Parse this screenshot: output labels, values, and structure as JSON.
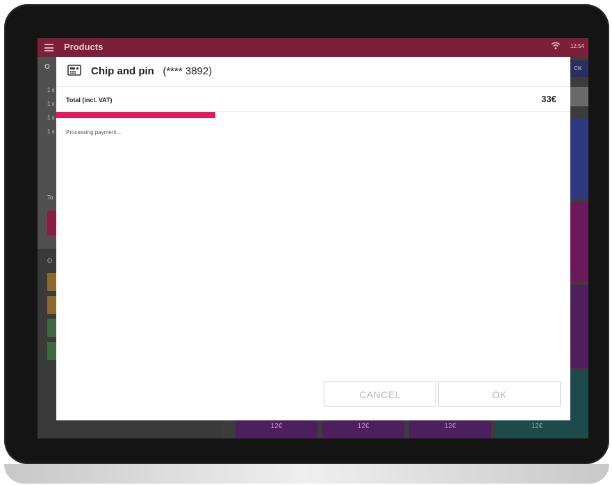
{
  "app": {
    "title": "Products",
    "time": "12:54",
    "stock_label": "CK",
    "order_header": "O",
    "order_rows": [
      "1 x",
      "1 x",
      "1 x",
      "1 x"
    ],
    "total_label_cut": "To",
    "lower_header": "O",
    "tile_prices": [
      "12€",
      "12€",
      "12€",
      "12€"
    ]
  },
  "dialog": {
    "title_bold": "Chip and pin",
    "title_card": "(**** 3892)",
    "total_label": "Total (incl. VAT)",
    "total_value": "33€",
    "progress": 0.31,
    "status_text": "Processing payment...",
    "cancel_label": "CANCEL",
    "ok_label": "OK",
    "icon": "card-reader-icon"
  },
  "colors": {
    "appbar": "#7d1f3a",
    "progress": "#e6195f"
  }
}
